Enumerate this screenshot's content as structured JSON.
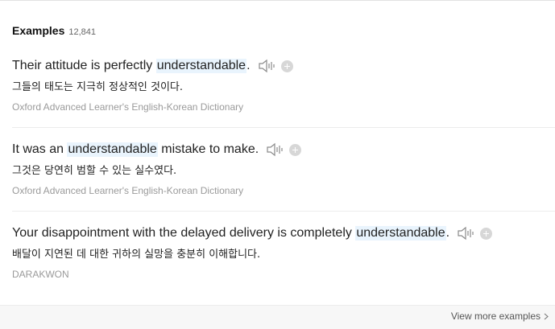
{
  "header": {
    "title": "Examples",
    "count": "12,841"
  },
  "examples": [
    {
      "before": "Their attitude is perfectly ",
      "highlight": "understandable",
      "after": ".",
      "translation": "그들의 태도는 지극히 정상적인 것이다.",
      "source": "Oxford Advanced Learner's English-Korean Dictionary"
    },
    {
      "before": "It was an ",
      "highlight": "understandable",
      "after": " mistake to make.",
      "translation": "그것은 당연히 범할 수 있는 실수였다.",
      "source": "Oxford Advanced Learner's English-Korean Dictionary"
    },
    {
      "before": "Your disappointment with the delayed delivery is completely ",
      "highlight": "understandable",
      "after": ".",
      "translation": "배달이 지연된 데 대한 귀하의 실망을 충분히 이해합니다.",
      "source": "DARAKWON"
    }
  ],
  "footer": {
    "view_more_label": "View more examples"
  },
  "icons": {
    "audio": "speaker-icon",
    "add": "plus-circle-icon",
    "more": "chevron-right-icon"
  },
  "colors": {
    "highlight_bg": "#e9f4fd",
    "source_text": "#9a9a9a",
    "add_icon": "#d7d7d7"
  }
}
